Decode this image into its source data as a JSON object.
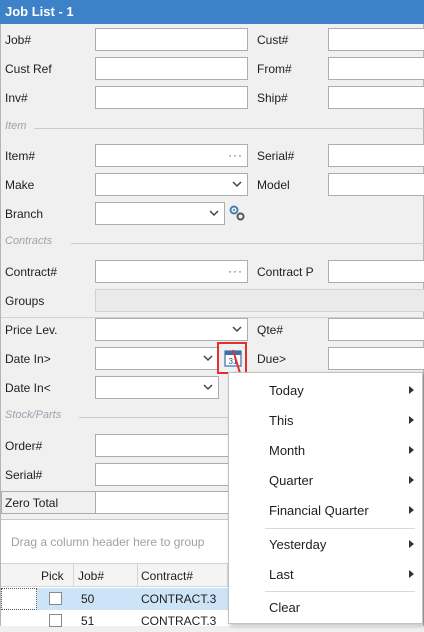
{
  "window": {
    "title": "Job List - 1"
  },
  "fields": {
    "job": "Job#",
    "cust": "Cust#",
    "cust_ref": "Cust Ref",
    "from": "From#",
    "inv": "Inv#",
    "ship": "Ship#",
    "item": "Item#",
    "serial": "Serial#",
    "make": "Make",
    "model": "Model",
    "branch": "Branch",
    "contract": "Contract#",
    "contract_p": "Contract P",
    "groups": "Groups",
    "price_lev": "Price Lev.",
    "qte": "Qte#",
    "date_in_gt": "Date In>",
    "due_gt": "Due>",
    "date_in_lt": "Date In<",
    "order": "Order#",
    "serial2": "Serial#",
    "zero_total": "Zero Total"
  },
  "sections": {
    "item": "Item",
    "contracts": "Contracts",
    "stock_parts": "Stock/Parts"
  },
  "calendar_icon": {
    "icon": "calendar-icon",
    "day": "31"
  },
  "grid": {
    "group_hint": "Drag a column header here to group",
    "columns": [
      "Pick",
      "Job#",
      "Contract#"
    ],
    "rows": [
      {
        "job": "50",
        "contract": "CONTRACT.3"
      },
      {
        "job": "51",
        "contract": "CONTRACT.3"
      }
    ]
  },
  "menu": {
    "items": [
      "Today",
      "This",
      "Month",
      "Quarter",
      "Financial Quarter",
      "Yesterday",
      "Last",
      "Clear"
    ]
  },
  "colors": {
    "title_bar": "#3d82c8",
    "highlight": "#e03030",
    "row_selected": "#cde3f7"
  }
}
